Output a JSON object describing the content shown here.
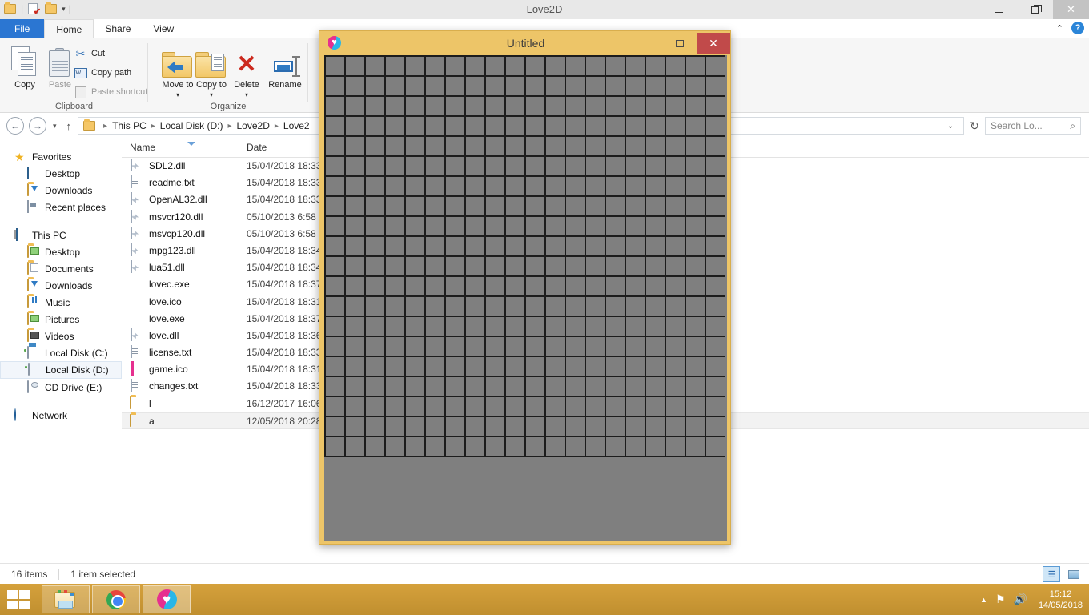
{
  "explorer": {
    "window_title": "Love2D",
    "window_controls": {
      "minimize": "–",
      "restore": "❐",
      "close": "✕"
    },
    "quick_access": {
      "caret": "▾",
      "sep1": "|",
      "sep2": "|"
    },
    "tabs": [
      {
        "label": "File",
        "id": "file"
      },
      {
        "label": "Home",
        "id": "home"
      },
      {
        "label": "Share",
        "id": "share"
      },
      {
        "label": "View",
        "id": "view"
      }
    ],
    "ribbon_right": {
      "collapse": "⌃",
      "help": "?"
    },
    "ribbon": {
      "clipboard": {
        "group_label": "Clipboard",
        "copy": "Copy",
        "paste": "Paste",
        "cut": "Cut",
        "copy_path": "Copy path",
        "paste_shortcut": "Paste shortcut",
        "copy_path_glyph": "W..."
      },
      "organize": {
        "group_label": "Organize",
        "move_to": "Move to",
        "copy_to": "Copy to",
        "delete": "Delete",
        "rename": "Rename",
        "caret": "▾"
      }
    },
    "address": {
      "back": "←",
      "forward": "→",
      "history_caret": "▾",
      "up": "↑",
      "breadcrumbs": [
        "This PC",
        "Local Disk (D:)",
        "Love2D",
        "Love2"
      ],
      "separator": "▸",
      "dropdown": "⌄",
      "refresh": "↻",
      "search_placeholder": "Search Lo...",
      "search_icon": "⌕"
    },
    "nav_pane": [
      {
        "label": "Favorites",
        "icon": "star",
        "level": 0
      },
      {
        "label": "Desktop",
        "icon": "monitor",
        "level": 1
      },
      {
        "label": "Downloads",
        "icon": "folder-blue",
        "level": 1
      },
      {
        "label": "Recent places",
        "icon": "recent",
        "level": 1
      },
      {
        "label": "This PC",
        "icon": "pc",
        "level": 0,
        "spacer_before": true
      },
      {
        "label": "Desktop",
        "icon": "folder-desktop",
        "level": 1
      },
      {
        "label": "Documents",
        "icon": "folder-doc",
        "level": 1
      },
      {
        "label": "Downloads",
        "icon": "folder-blue",
        "level": 1
      },
      {
        "label": "Music",
        "icon": "folder-music",
        "level": 1
      },
      {
        "label": "Pictures",
        "icon": "folder-pic",
        "level": 1
      },
      {
        "label": "Videos",
        "icon": "folder-vid",
        "level": 1
      },
      {
        "label": "Local Disk (C:)",
        "icon": "drive-system",
        "level": 1
      },
      {
        "label": "Local Disk (D:)",
        "icon": "drive",
        "level": 1,
        "selected": true
      },
      {
        "label": "CD Drive (E:)",
        "icon": "cd-drive",
        "level": 1
      },
      {
        "label": "Network",
        "icon": "globe",
        "level": 0,
        "spacer_before": true
      }
    ],
    "columns": [
      {
        "label": "Name",
        "sorted": true
      },
      {
        "label": "Date",
        "sorted": false
      }
    ],
    "files": [
      {
        "name": "SDL2.dll",
        "date": "15/04/2018 18:33",
        "icon": "dll"
      },
      {
        "name": "readme.txt",
        "date": "15/04/2018 18:33",
        "icon": "txt"
      },
      {
        "name": "OpenAL32.dll",
        "date": "15/04/2018 18:33",
        "icon": "dll"
      },
      {
        "name": "msvcr120.dll",
        "date": "05/10/2013 6:58",
        "icon": "dll"
      },
      {
        "name": "msvcp120.dll",
        "date": "05/10/2013 6:58",
        "icon": "dll"
      },
      {
        "name": "mpg123.dll",
        "date": "15/04/2018 18:34",
        "icon": "dll"
      },
      {
        "name": "lua51.dll",
        "date": "15/04/2018 18:34",
        "icon": "dll"
      },
      {
        "name": "lovec.exe",
        "date": "15/04/2018 18:37",
        "icon": "love"
      },
      {
        "name": "love.ico",
        "date": "15/04/2018 18:31",
        "icon": "love"
      },
      {
        "name": "love.exe",
        "date": "15/04/2018 18:37",
        "icon": "love"
      },
      {
        "name": "love.dll",
        "date": "15/04/2018 18:36",
        "icon": "dll"
      },
      {
        "name": "license.txt",
        "date": "15/04/2018 18:33",
        "icon": "txt"
      },
      {
        "name": "game.ico",
        "date": "15/04/2018 18:31",
        "icon": "gameico"
      },
      {
        "name": "changes.txt",
        "date": "15/04/2018 18:33",
        "icon": "txt"
      },
      {
        "name": "l",
        "date": "16/12/2017 16:06",
        "icon": "folder"
      },
      {
        "name": "a",
        "date": "12/05/2018 20:28",
        "icon": "folder",
        "selected": true
      }
    ],
    "status": {
      "item_count": "16 items",
      "selection": "1 item selected"
    },
    "view_buttons": {
      "details": "details-view",
      "large_icons": "large-icons-view"
    }
  },
  "love_window": {
    "title": "Untitled",
    "controls": {
      "minimize": "–",
      "maximize": "❐",
      "close": "✕"
    },
    "colors": {
      "chrome": "#edc568",
      "canvas": "#7f7f7f",
      "grid_line": "#1c1c1c",
      "cell": "#7f7f7f"
    },
    "grid": {
      "columns": 20,
      "rows": 20,
      "cell_size": 25
    }
  },
  "taskbar": {
    "start": "start-button",
    "buttons": [
      {
        "name": "file-explorer",
        "icon": "explorer-icon",
        "active": false
      },
      {
        "name": "google-chrome",
        "icon": "chrome-icon",
        "active": false
      },
      {
        "name": "love2d",
        "icon": "love-icon",
        "active": true
      }
    ],
    "tray": {
      "show_hidden": "▲",
      "network": "⚑",
      "volume": "🔊",
      "time": "15:12",
      "date": "14/05/2018"
    }
  }
}
